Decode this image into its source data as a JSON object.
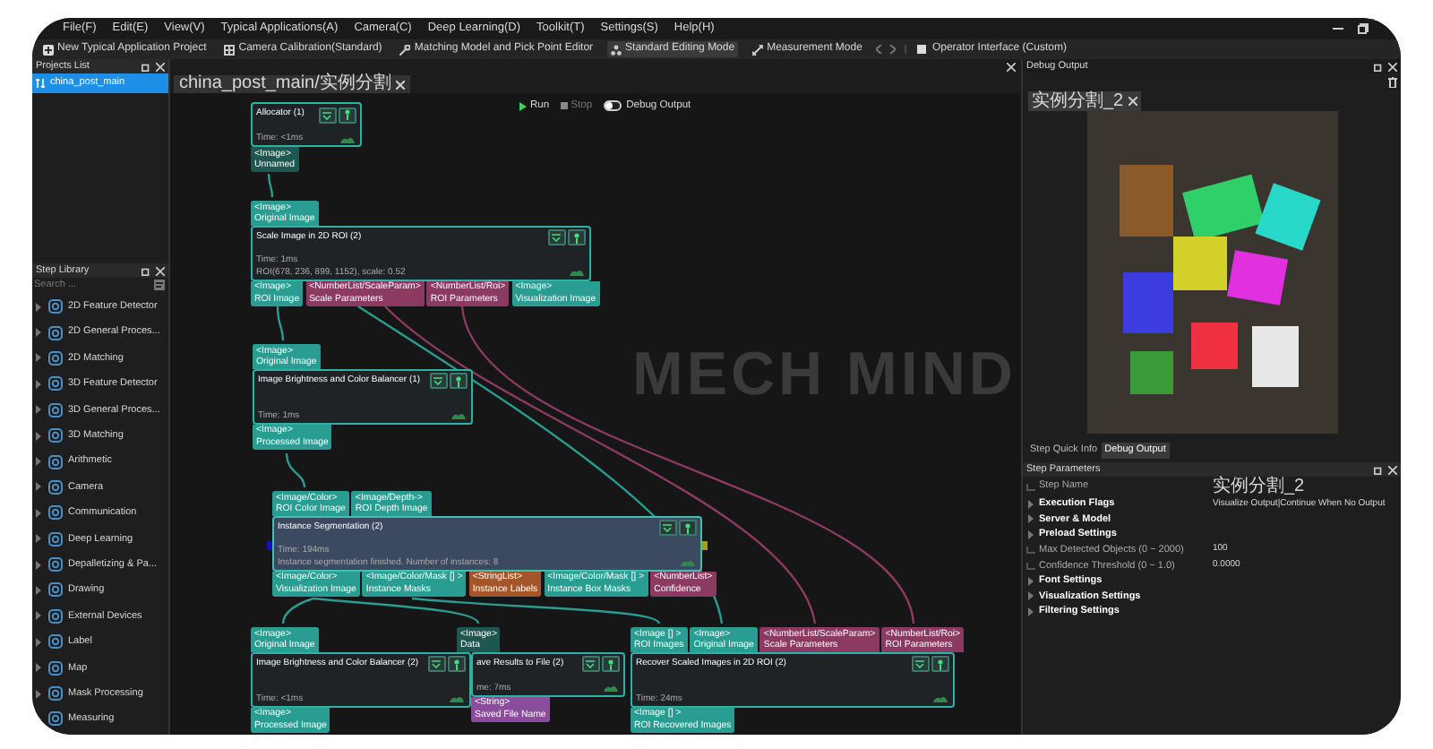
{
  "menu": [
    "File(F)",
    "Edit(E)",
    "View(V)",
    "Typical Applications(A)",
    "Camera(C)",
    "Deep Learning(D)",
    "Toolkit(T)",
    "Settings(S)",
    "Help(H)"
  ],
  "toolbar": [
    {
      "kind": "button",
      "label": "New Typical Application Project"
    },
    {
      "kind": "button",
      "label": "Camera Calibration(Standard)"
    },
    {
      "kind": "button",
      "label": "Matching Model and Pick Point Editor"
    },
    {
      "kind": "mode",
      "label": "Standard Editing Mode",
      "selected": true
    },
    {
      "kind": "mode",
      "label": "Measurement Mode",
      "selected": false
    },
    {
      "kind": "nav"
    },
    {
      "kind": "check",
      "label": "Operator Interface (Custom)"
    }
  ],
  "projects_list": {
    "title": "Projects List",
    "items": [
      {
        "label": "china_post_main",
        "selected": true
      }
    ]
  },
  "step_library": {
    "title": "Step Library",
    "search": {
      "placeholder": "Search ..."
    },
    "items": [
      {
        "label": "2D Feature Detector",
        "expanded": false
      },
      {
        "label": "2D General Proces...",
        "expanded": false
      },
      {
        "label": "2D Matching",
        "expanded": false
      },
      {
        "label": "3D Feature Detector",
        "expanded": false
      },
      {
        "label": "3D General Proces...",
        "expanded": false
      },
      {
        "label": "3D Matching",
        "expanded": false
      },
      {
        "label": "Arithmetic",
        "expanded": false
      },
      {
        "label": "Camera",
        "expanded": false
      },
      {
        "label": "Communication",
        "expanded": false
      },
      {
        "label": "Deep Learning",
        "expanded": false
      },
      {
        "label": "Depalletizing & Pa...",
        "expanded": false
      },
      {
        "label": "Drawing",
        "expanded": false
      },
      {
        "label": "External Devices",
        "expanded": false
      },
      {
        "label": "Label",
        "expanded": false
      },
      {
        "label": "Map",
        "expanded": false
      },
      {
        "label": "Mask Processing",
        "expanded": false
      },
      {
        "label": "Measuring",
        "expanded": false
      }
    ]
  },
  "editor": {
    "tabs": [
      {
        "label": "china_post_main/实例分割",
        "selected": true
      }
    ],
    "run_bar": {
      "run": "Run",
      "stop": "Stop",
      "debug_output": {
        "label": "Debug Output",
        "on": false
      }
    },
    "canvas_logo": "MECH MIND",
    "nodes": [
      {
        "title": "Allocator (1)",
        "lines": [
          "Time: <1ms"
        ],
        "selected": false,
        "outputs": [
          {
            "type": "<Image>",
            "name": "Unnamed",
            "color": "#1f5650"
          }
        ]
      },
      {
        "title": "Scale Image in 2D ROI (2)",
        "lines": [
          "Time: 1ms",
          "ROI(678, 236, 899, 1152), scale: 0.52"
        ],
        "selected": false,
        "inputs": [
          {
            "type": "<Image>",
            "name": "Original Image",
            "color": "#2a9d92"
          }
        ],
        "outputs": [
          {
            "type": "<Image>",
            "name": "ROI Image",
            "color": "#2a9d92"
          },
          {
            "type": "<NumberList/ScaleParam>",
            "name": "Scale Parameters",
            "color": "#8c3a62"
          },
          {
            "type": "<NumberList/Roi>",
            "name": "ROI Parameters",
            "color": "#8c3a62"
          },
          {
            "type": "<Image>",
            "name": "Visualization Image",
            "color": "#2a9d92"
          }
        ]
      },
      {
        "title": "Image Brightness and Color Balancer (1)",
        "lines": [
          "Time: 1ms"
        ],
        "selected": false,
        "inputs": [
          {
            "type": "<Image>",
            "name": "Original Image",
            "color": "#2a9d92"
          }
        ],
        "outputs": [
          {
            "type": "<Image>",
            "name": "Processed Image",
            "color": "#2a9d92"
          }
        ]
      },
      {
        "title": "Instance Segmentation (2)",
        "lines": [
          "Time: 194ms",
          "Instance segmentation finished. Number of instances: 8"
        ],
        "selected": true,
        "inputs": [
          {
            "type": "<Image/Color>",
            "name": "ROI Color Image",
            "color": "#2a9d92"
          },
          {
            "type": "<Image/Depth->",
            "name": "ROI Depth Image",
            "color": "#2a9d92"
          }
        ],
        "outputs": [
          {
            "type": "<Image/Color>",
            "name": "Visualization Image",
            "color": "#2a9d92"
          },
          {
            "type": "<Image/Color/Mask [] >",
            "name": "Instance Masks",
            "color": "#2a9d92"
          },
          {
            "type": "<StringList>",
            "name": "Instance Labels",
            "color": "#a4552a"
          },
          {
            "type": "<Image/Color/Mask [] >",
            "name": "Instance Box Masks",
            "color": "#2a9d92"
          },
          {
            "type": "<NumberList>",
            "name": "Confidence",
            "color": "#8c3a62"
          }
        ]
      },
      {
        "title": "Image Brightness and Color Balancer (2)",
        "lines": [
          "Time: <1ms"
        ],
        "selected": false,
        "inputs": [
          {
            "type": "<Image>",
            "name": "Original Image",
            "color": "#2a9d92"
          }
        ],
        "outputs": [
          {
            "type": "<Image>",
            "name": "Processed Image",
            "color": "#2a9d92"
          }
        ]
      },
      {
        "title": "ave Results to File (2)",
        "lines": [
          "me: 7ms"
        ],
        "selected": false,
        "inputs": [
          {
            "type": "<Image>",
            "name": "Data",
            "color": "#1f5650"
          }
        ],
        "outputs": [
          {
            "type": "<String>",
            "name": "Saved File Name",
            "color": "#8a4d9c"
          }
        ]
      },
      {
        "title": "Recover Scaled Images in 2D ROI (2)",
        "lines": [
          "Time: 24ms"
        ],
        "selected": false,
        "inputs": [
          {
            "type": "<Image [] >",
            "name": "ROI Images",
            "color": "#2a9d92"
          },
          {
            "type": "<Image>",
            "name": "Original Image",
            "color": "#2a9d92"
          },
          {
            "type": "<NumberList/ScaleParam>",
            "name": "Scale Parameters",
            "color": "#8c3a62"
          },
          {
            "type": "<NumberList/Roi>",
            "name": "ROI Parameters",
            "color": "#8c3a62"
          }
        ],
        "outputs": [
          {
            "type": "<Image [] >",
            "name": "ROI Recovered Images",
            "color": "#2a9d92"
          }
        ]
      }
    ]
  },
  "debug_output": {
    "title": "Debug Output",
    "tabs": [
      {
        "label": "实例分割_2",
        "selected": true
      }
    ]
  },
  "info_tabs": [
    {
      "label": "Step Quick Info",
      "selected": false
    },
    {
      "label": "Debug Output",
      "selected": true
    }
  ],
  "step_parameters": {
    "title": "Step Parameters",
    "rows": [
      {
        "kind": "field",
        "label": "Step Name",
        "value": "实例分割_2"
      },
      {
        "kind": "group",
        "label": "Execution Flags",
        "value": "Visualize Output|Continue When No Output",
        "expanded": false
      },
      {
        "kind": "group",
        "label": "Server & Model",
        "expanded": false
      },
      {
        "kind": "group",
        "label": "Preload Settings",
        "expanded": false
      },
      {
        "kind": "field",
        "label": "Max Detected Objects (0 ~ 2000)",
        "value": "100"
      },
      {
        "kind": "field",
        "label": "Confidence Threshold (0 ~ 1.0)",
        "value": "0.0000"
      },
      {
        "kind": "group",
        "label": "Font Settings",
        "expanded": false
      },
      {
        "kind": "group",
        "label": "Visualization Settings",
        "expanded": false
      },
      {
        "kind": "group",
        "label": "Filtering Settings",
        "expanded": false
      }
    ]
  }
}
